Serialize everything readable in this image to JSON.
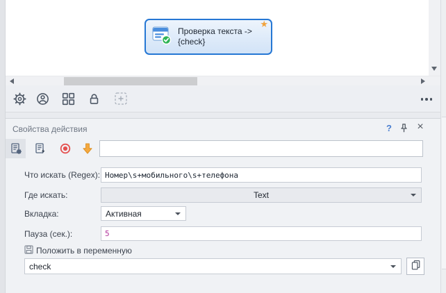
{
  "canvas": {
    "node": {
      "title_line1": "Проверка текста ->",
      "title_line2": "{check}",
      "star": "★"
    },
    "toolbar_icon_names": [
      "gear-icon",
      "user-icon",
      "grid-icon",
      "lock-icon",
      "add-capture-icon"
    ]
  },
  "panel": {
    "title": "Свойства действия",
    "help_label": "?",
    "close_label": "×",
    "toolbar_search_value": "",
    "fields": {
      "what": {
        "label": "Что искать (Regex):",
        "value": "Номер\\s+мобильного\\s+телефона"
      },
      "where": {
        "label": "Где искать:",
        "value": "Text"
      },
      "tab": {
        "label": "Вкладка:",
        "value": "Активная"
      },
      "pause": {
        "label": "Пауза (сек.):",
        "value": "5"
      }
    },
    "variable": {
      "label": "Положить в переменную",
      "value": "check"
    }
  },
  "colors": {
    "node_border": "#2577d4",
    "node_fill": "#d2e3f7",
    "star": "#f0a23c",
    "record_red": "#e4504f",
    "arrow_amber": "#f5a93f",
    "help_blue": "#4a7fd0",
    "pause_value_text": "#b1359c",
    "icon_slate": "#4d5765"
  }
}
